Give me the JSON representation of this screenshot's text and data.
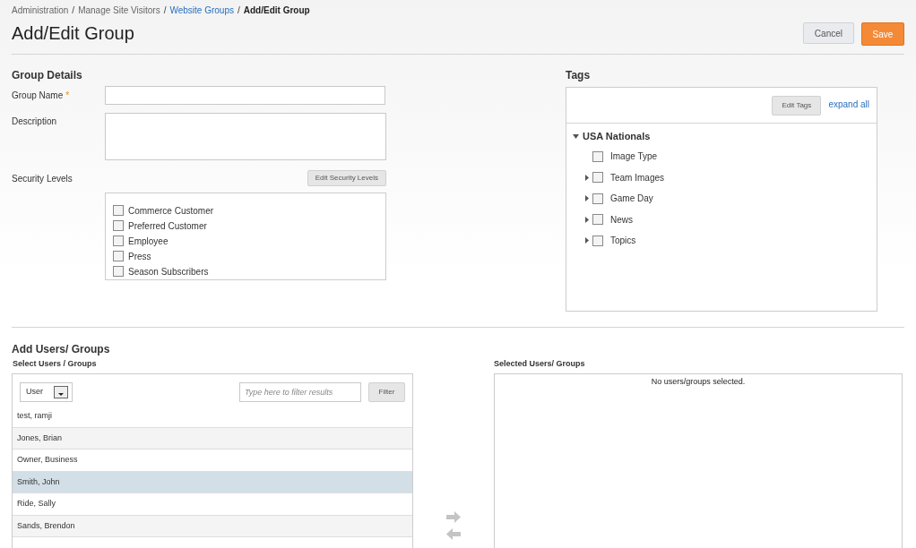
{
  "breadcrumbs": [
    {
      "label": "Administration",
      "visited": true,
      "current": false,
      "separator": "/"
    },
    {
      "label": "Manage Site Visitors",
      "visited": true,
      "current": false,
      "separator": "/"
    },
    {
      "label": "Website Groups",
      "visited": false,
      "current": false,
      "separator": "/"
    },
    {
      "label": "Add/Edit Group",
      "current": true
    }
  ],
  "page_title": "Add/Edit Group",
  "actions": {
    "cancel": "Cancel",
    "save": "Save"
  },
  "group_details": {
    "heading": "Group Details",
    "group_name": {
      "label": "Group Name",
      "required_mark": "*"
    },
    "description": {
      "label": "Description"
    },
    "security_levels": {
      "label": "Security Levels",
      "edit_button": "Edit Security Levels",
      "options": [
        {
          "label": "Commerce Customer",
          "checked": false
        },
        {
          "label": "Preferred Customer",
          "checked": false
        },
        {
          "label": "Employee",
          "checked": false
        },
        {
          "label": "Press",
          "checked": false
        },
        {
          "label": "Season Subscribers",
          "checked": false
        }
      ]
    }
  },
  "tags": {
    "heading": "Tags",
    "edit_button": "Edit Tags",
    "expand_all": "expand all",
    "tree": [
      {
        "label": "USA Nationals",
        "expanded": true,
        "children": [
          {
            "label": "Image Type",
            "expandable": false,
            "checked": false
          },
          {
            "label": "Team Images",
            "expandable": true,
            "checked": false
          },
          {
            "label": "Game Day",
            "expandable": true,
            "checked": false
          },
          {
            "label": "News",
            "expandable": true,
            "checked": false
          },
          {
            "label": "Topics",
            "expandable": true,
            "checked": false
          }
        ]
      }
    ]
  },
  "add_users": {
    "heading": "Add Users/ Groups",
    "select_heading": "Select Users / Groups",
    "type_select": "User",
    "filter": {
      "placeholder": "Type here to filter results",
      "button": "Filter"
    },
    "users": [
      {
        "name": "test, ramji",
        "selected": false
      },
      {
        "name": "Jones, Brian",
        "selected": false
      },
      {
        "name": "Owner, Business",
        "selected": false
      },
      {
        "name": "Smith, John",
        "selected": true
      },
      {
        "name": "Ride, Sally",
        "selected": false
      },
      {
        "name": "Sands, Brendon",
        "selected": false
      }
    ],
    "selected_heading": "Selected Users/ Groups",
    "selected_empty": "No users/groups selected."
  }
}
